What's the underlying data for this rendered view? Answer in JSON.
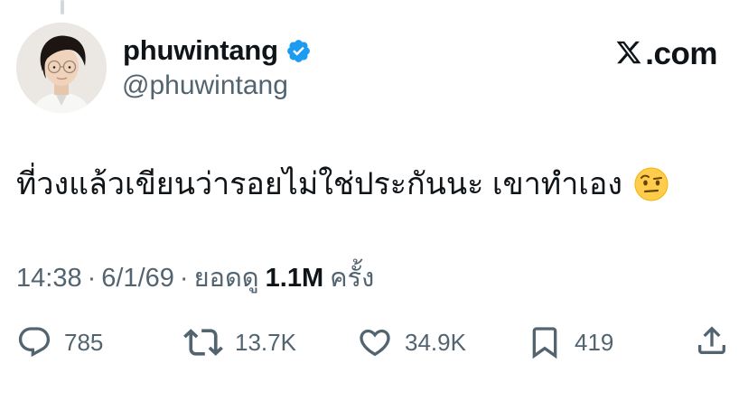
{
  "author": {
    "display_name": "phuwintang",
    "handle": "@phuwintang",
    "verified": true
  },
  "brand": {
    "logo_icon": "x-logo-icon",
    "text": ".com"
  },
  "tweet": {
    "text": "ที่วงแล้วเขียนว่ารอยไม่ใช่ประกันนะ เขาทำเอง",
    "emoji": "raised-eyebrow-emoji"
  },
  "meta": {
    "time": "14:38",
    "separator": "·",
    "date": "6/1/69",
    "views_prefix": "ยอดดู",
    "views_count": "1.1M",
    "views_suffix": "ครั้ง"
  },
  "actions": {
    "replies": "785",
    "reposts": "13.7K",
    "likes": "34.9K",
    "bookmarks": "419"
  },
  "colors": {
    "text_primary": "#0f1419",
    "text_secondary": "#536471",
    "verified_blue": "#1d9bf0",
    "thread_line": "#cfd9de"
  }
}
